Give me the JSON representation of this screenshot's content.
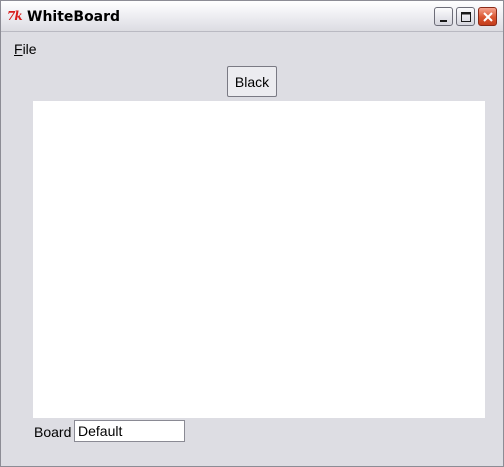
{
  "window": {
    "title": "WhiteBoard",
    "app_icon": "tk-icon",
    "controls": {
      "minimize_icon": "minimize-icon",
      "maximize_icon": "maximize-icon",
      "close_icon": "close-icon"
    }
  },
  "menubar": {
    "file_accel": "F",
    "file_rest": "ile"
  },
  "toolbar": {
    "color_button_label": "Black"
  },
  "canvas": {
    "background": "#ffffff"
  },
  "footer": {
    "board_label": "Board",
    "board_value": "Default"
  },
  "colors": {
    "window_bg": "#dddde3",
    "close_button": "#d9542f"
  }
}
